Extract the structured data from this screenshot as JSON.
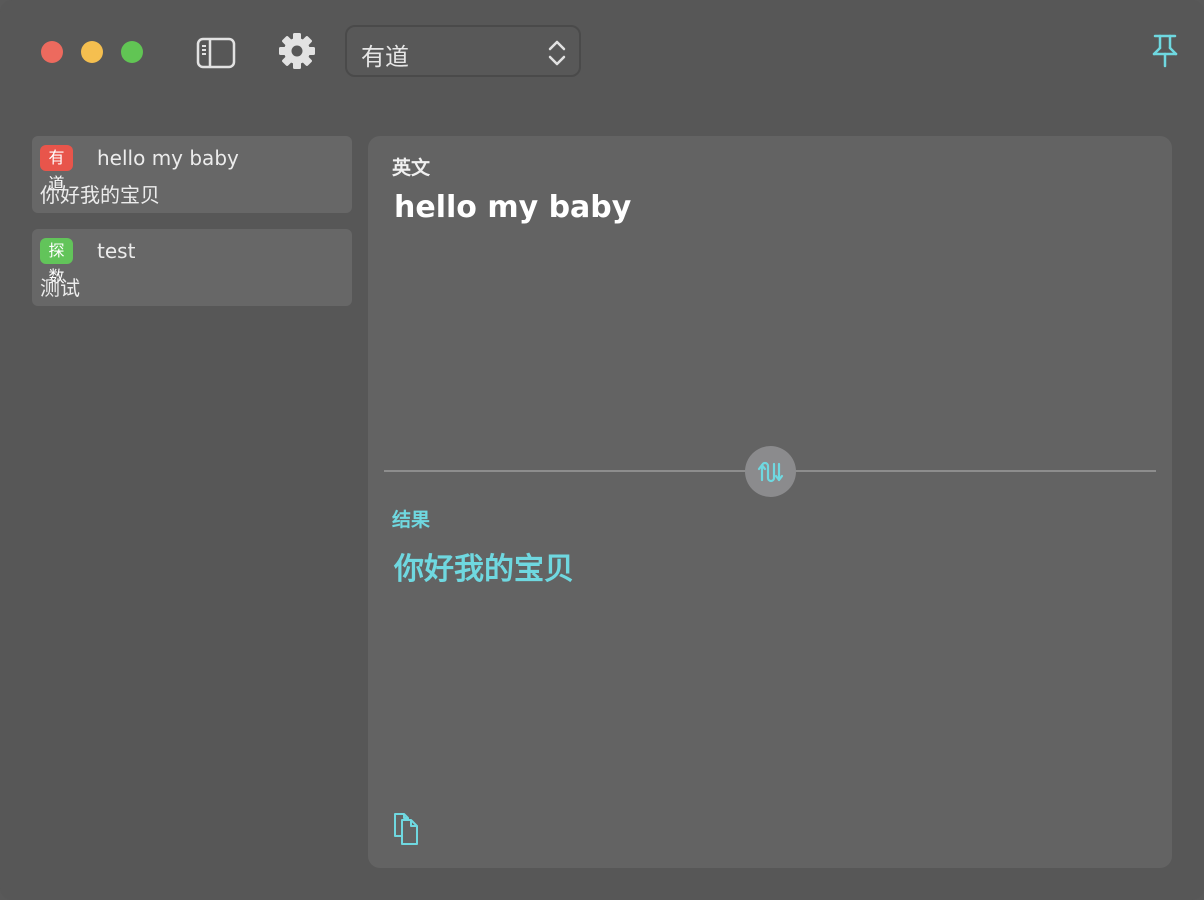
{
  "toolbar": {
    "engine_select": {
      "value": "有道"
    }
  },
  "history": [
    {
      "badge": "有道",
      "badge_color": "#e8554b",
      "source": "hello my baby",
      "result": "你好我的宝贝"
    },
    {
      "badge": "探数",
      "badge_color": "#62c45a",
      "source": "test",
      "result": "测试"
    }
  ],
  "main": {
    "source_language": "英文",
    "source_text": "hello my baby",
    "result_label": "结果",
    "result_text": "你好我的宝贝"
  },
  "icons": {
    "sidebar_toggle": "sidebar-icon",
    "settings": "gear-icon",
    "select_chevrons": "chevron-up-down-icon",
    "pin": "pin-icon",
    "swap": "swap-icon",
    "copy": "copy-icon"
  },
  "colors": {
    "accent": "#6fd8e0",
    "window_bg": "#575757",
    "panel_bg": "#636363"
  }
}
